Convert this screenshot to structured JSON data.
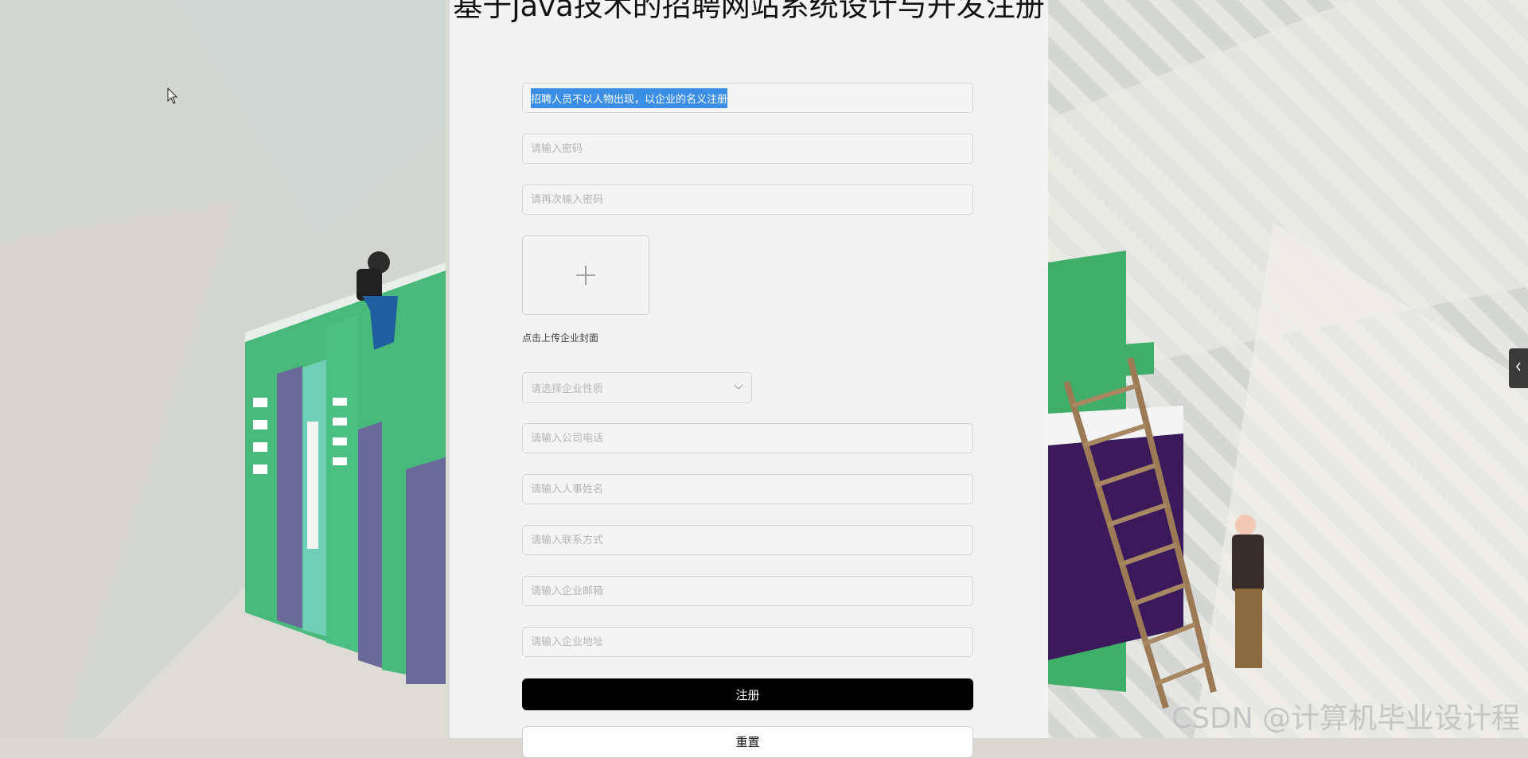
{
  "title": "基于java技术的招聘网站系统设计与开发注册",
  "form": {
    "company_name_value": "招聘人员不以人物出现，以企业的名义注册",
    "password_placeholder": "请输入密码",
    "password_confirm_placeholder": "请再次输入密码",
    "upload_label": "点击上传企业封面",
    "nature_placeholder": "请选择企业性质",
    "phone_placeholder": "请输入公司电话",
    "hr_name_placeholder": "请输入人事姓名",
    "contact_placeholder": "请输入联系方式",
    "email_placeholder": "请输入企业邮箱",
    "address_placeholder": "请输入企业地址",
    "register_label": "注册",
    "reset_label": "重置"
  },
  "watermark": "CSDN @计算机毕业设计程",
  "colors": {
    "selection": "#3a8ee6",
    "primary_button": "#000000",
    "panel": "#f3f3f3"
  }
}
